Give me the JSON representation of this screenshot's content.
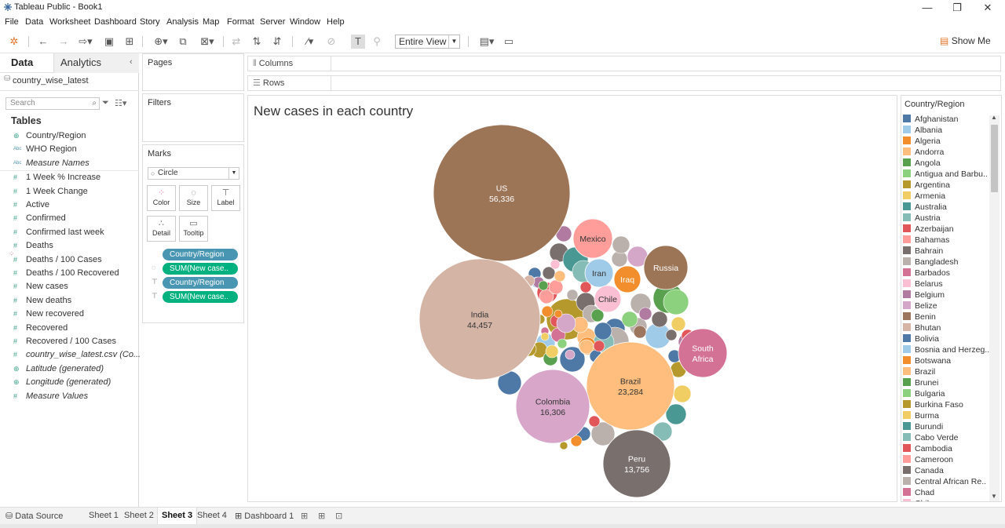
{
  "window": {
    "title": "Tableau Public - Book1",
    "minimize": "—",
    "maximize": "❐",
    "close": "✕"
  },
  "menu": [
    "File",
    "Data",
    "Worksheet",
    "Dashboard",
    "Story",
    "Analysis",
    "Map",
    "Format",
    "Server",
    "Window",
    "Help"
  ],
  "toolbar": {
    "view_select": "Entire View",
    "show_me": "Show Me"
  },
  "left_pane": {
    "tabs": {
      "data": "Data",
      "analytics": "Analytics"
    },
    "data_source": "country_wise_latest",
    "search_placeholder": "Search",
    "tables_header": "Tables",
    "fields": [
      {
        "name": "Country/Region",
        "type": "geo",
        "italic": false
      },
      {
        "name": "WHO Region",
        "type": "abc",
        "italic": false
      },
      {
        "name": "Measure Names",
        "type": "abc",
        "italic": true
      },
      {
        "name": "1 Week % Increase",
        "type": "num",
        "italic": false
      },
      {
        "name": "1 Week Change",
        "type": "num",
        "italic": false
      },
      {
        "name": "Active",
        "type": "num",
        "italic": false
      },
      {
        "name": "Confirmed",
        "type": "num",
        "italic": false
      },
      {
        "name": "Confirmed last week",
        "type": "num",
        "italic": false
      },
      {
        "name": "Deaths",
        "type": "num",
        "italic": false
      },
      {
        "name": "Deaths / 100 Cases",
        "type": "num",
        "italic": false
      },
      {
        "name": "Deaths / 100 Recovered",
        "type": "num",
        "italic": false
      },
      {
        "name": "New cases",
        "type": "num",
        "italic": false
      },
      {
        "name": "New deaths",
        "type": "num",
        "italic": false
      },
      {
        "name": "New recovered",
        "type": "num",
        "italic": false
      },
      {
        "name": "Recovered",
        "type": "num",
        "italic": false
      },
      {
        "name": "Recovered / 100 Cases",
        "type": "num",
        "italic": false
      },
      {
        "name": "country_wise_latest.csv (Co...",
        "type": "num",
        "italic": true
      },
      {
        "name": "Latitude (generated)",
        "type": "geo",
        "italic": true
      },
      {
        "name": "Longitude (generated)",
        "type": "geo",
        "italic": true
      },
      {
        "name": "Measure Values",
        "type": "num",
        "italic": true
      }
    ]
  },
  "cards": {
    "pages": "Pages",
    "filters": "Filters",
    "marks": "Marks",
    "mark_type": "Circle",
    "buttons": [
      "Color",
      "Size",
      "Label",
      "Detail",
      "Tooltip"
    ],
    "pills": [
      {
        "label": "Country/Region",
        "kind": "dim",
        "icon": "color-icon"
      },
      {
        "label": "SUM(New case..",
        "kind": "meas",
        "icon": "size-icon"
      },
      {
        "label": "Country/Region",
        "kind": "dim",
        "icon": "label-icon"
      },
      {
        "label": "SUM(New case..",
        "kind": "meas",
        "icon": "label-icon"
      }
    ]
  },
  "shelves": {
    "columns": "Columns",
    "rows": "Rows"
  },
  "viz": {
    "title": "New cases in each country"
  },
  "chart_data": {
    "type": "packed-bubble",
    "title": "New cases in each country",
    "measure": "SUM(New cases)",
    "color_dimension": "Country/Region",
    "labeled_bubbles": [
      {
        "country": "US",
        "value": "56,336",
        "color": "#9c7456"
      },
      {
        "country": "India",
        "value": "44,457",
        "color": "#d4b4a4"
      },
      {
        "country": "Brazil",
        "value": "23,284",
        "color": "#ffbe7d"
      },
      {
        "country": "Colombia",
        "value": "16,306",
        "color": "#d7a6c9"
      },
      {
        "country": "Peru",
        "value": "13,756",
        "color": "#79706e"
      },
      {
        "country": "South Africa",
        "value": "",
        "color": "#d37295"
      },
      {
        "country": "Russia",
        "value": "",
        "color": "#9c7456"
      },
      {
        "country": "Mexico",
        "value": "",
        "color": "#ff9d9a"
      },
      {
        "country": "Iran",
        "value": "",
        "color": "#a0cbe8"
      },
      {
        "country": "Iraq",
        "value": "",
        "color": "#f28e2b"
      },
      {
        "country": "Chile",
        "value": "",
        "color": "#fabfd2"
      }
    ]
  },
  "legend": {
    "title": "Country/Region",
    "items": [
      {
        "label": "Afghanistan",
        "color": "#4e79a7"
      },
      {
        "label": "Albania",
        "color": "#a0cbe8"
      },
      {
        "label": "Algeria",
        "color": "#f28e2b"
      },
      {
        "label": "Andorra",
        "color": "#ffbe7d"
      },
      {
        "label": "Angola",
        "color": "#59a14f"
      },
      {
        "label": "Antigua and Barbu..",
        "color": "#8cd17d"
      },
      {
        "label": "Argentina",
        "color": "#b6992d"
      },
      {
        "label": "Armenia",
        "color": "#f1ce63"
      },
      {
        "label": "Australia",
        "color": "#499894"
      },
      {
        "label": "Austria",
        "color": "#86bcb6"
      },
      {
        "label": "Azerbaijan",
        "color": "#e15759"
      },
      {
        "label": "Bahamas",
        "color": "#ff9d9a"
      },
      {
        "label": "Bahrain",
        "color": "#79706e"
      },
      {
        "label": "Bangladesh",
        "color": "#bab0ac"
      },
      {
        "label": "Barbados",
        "color": "#d37295"
      },
      {
        "label": "Belarus",
        "color": "#fabfd2"
      },
      {
        "label": "Belgium",
        "color": "#b07aa1"
      },
      {
        "label": "Belize",
        "color": "#d4a6c8"
      },
      {
        "label": "Benin",
        "color": "#9d7660"
      },
      {
        "label": "Bhutan",
        "color": "#d7b5a6"
      },
      {
        "label": "Bolivia",
        "color": "#4e79a7"
      },
      {
        "label": "Bosnia and Herzeg..",
        "color": "#a0cbe8"
      },
      {
        "label": "Botswana",
        "color": "#f28e2b"
      },
      {
        "label": "Brazil",
        "color": "#ffbe7d"
      },
      {
        "label": "Brunei",
        "color": "#59a14f"
      },
      {
        "label": "Bulgaria",
        "color": "#8cd17d"
      },
      {
        "label": "Burkina Faso",
        "color": "#b6992d"
      },
      {
        "label": "Burma",
        "color": "#f1ce63"
      },
      {
        "label": "Burundi",
        "color": "#499894"
      },
      {
        "label": "Cabo Verde",
        "color": "#86bcb6"
      },
      {
        "label": "Cambodia",
        "color": "#e15759"
      },
      {
        "label": "Cameroon",
        "color": "#ff9d9a"
      },
      {
        "label": "Canada",
        "color": "#79706e"
      },
      {
        "label": "Central African Re..",
        "color": "#bab0ac"
      },
      {
        "label": "Chad",
        "color": "#d37295"
      },
      {
        "label": "Chile",
        "color": "#fabfd2"
      }
    ]
  },
  "sheet_tabs": [
    "Data Source",
    "Sheet 1",
    "Sheet 2",
    "Sheet 3",
    "Sheet 4",
    "Dashboard 1"
  ],
  "active_tab": "Sheet 3"
}
